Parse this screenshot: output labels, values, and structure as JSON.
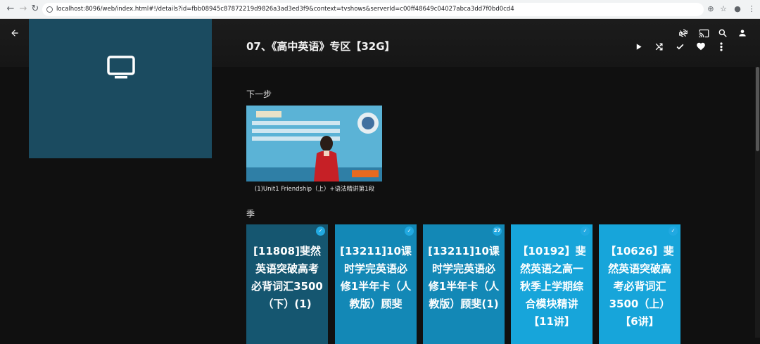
{
  "browser": {
    "url": "localhost:8096/web/index.html#!/details?id=fbb08945c87872219d9826a3ad3ed3f9&context=tvshows&serverId=c00ff48649c04027abca3dd7f0bd0cd4"
  },
  "header": {
    "icons": [
      "back-arrow-icon",
      "home-icon",
      "menu-icon",
      "sync-disabled-icon",
      "cast-icon",
      "search-icon",
      "user-icon"
    ]
  },
  "details": {
    "title": "07、《高中英语》专区【32G】",
    "actions": [
      "play-icon",
      "shuffle-icon",
      "check-icon",
      "heart-icon",
      "more-icon"
    ]
  },
  "next_up": {
    "heading": "下一步",
    "episode_caption": "(1)Unit1 Friendship（上）+语法精讲第1段"
  },
  "seasons": {
    "heading": "季",
    "items": [
      {
        "title": "[11808]斐然英语突破高考必背词汇3500（下）(1)",
        "badge": "check",
        "color": "#155670"
      },
      {
        "title": "[13211]10课时学完英语必修1半年卡（人教版）顾斐",
        "badge": "check",
        "color": "#1388b6"
      },
      {
        "title": "[13211]10课时学完英语必修1半年卡（人教版）顾斐(1)",
        "badge": "27",
        "color": "#1388b6"
      },
      {
        "title": "【10192】斐然英语之高一秋季上学期综合模块精讲【11讲】",
        "badge": "check",
        "color": "#17a5da"
      },
      {
        "title": "【10626】斐然英语突破高考必背词汇3500（上）【6讲】",
        "badge": "check",
        "color": "#17a5da"
      }
    ]
  },
  "colors": {
    "accent": "#21a9e1",
    "poster": "#1b4b60",
    "background": "#101010"
  }
}
